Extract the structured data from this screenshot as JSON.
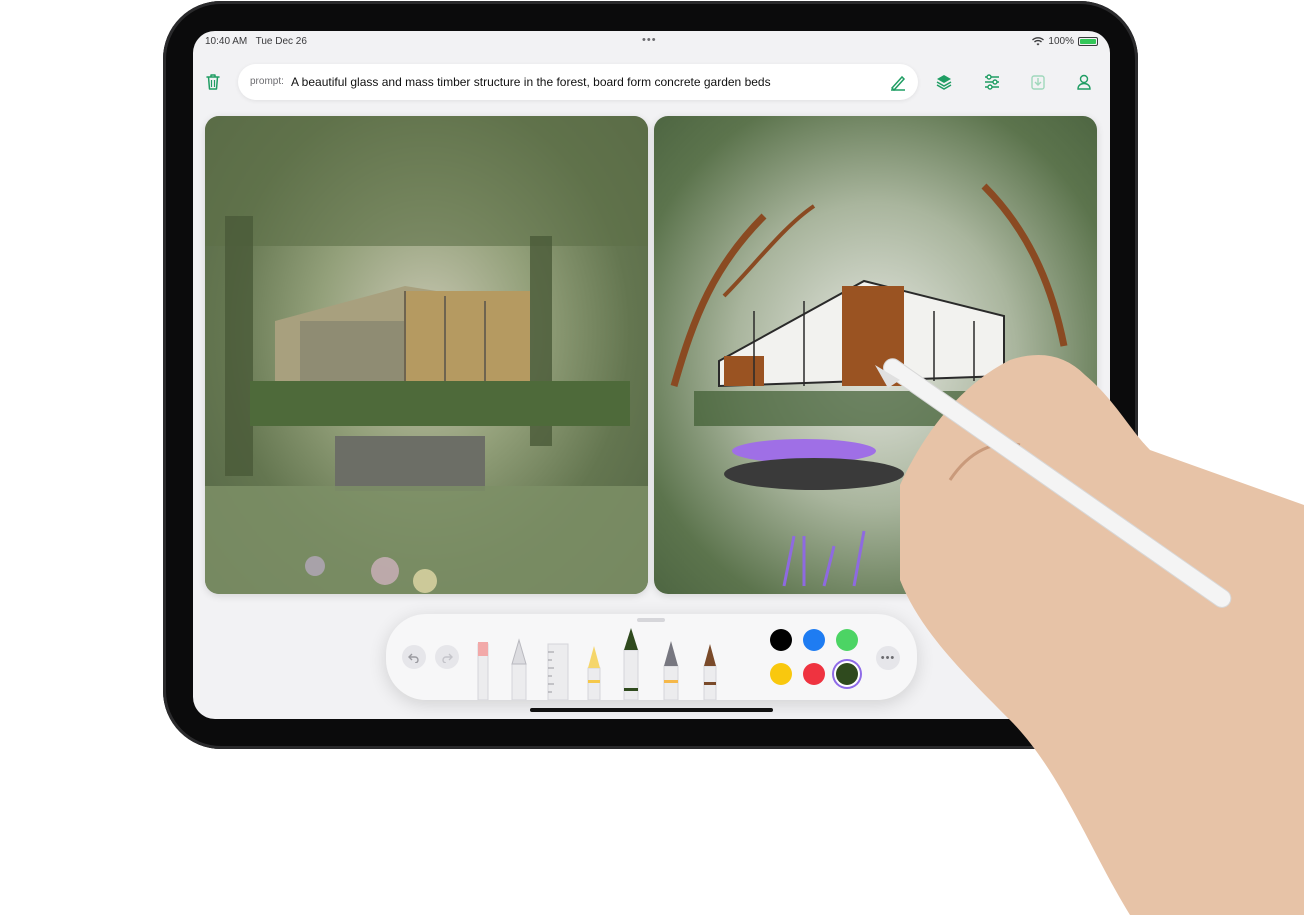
{
  "status_bar": {
    "time": "10:40 AM",
    "date": "Tue Dec 26",
    "more": "•••",
    "battery": "100%"
  },
  "toolbar": {
    "prompt_label": "prompt:",
    "prompt_text": "A beautiful glass and mass timber structure in the forest, board form concrete garden beds",
    "icons": [
      "trash-icon",
      "pencil-icon",
      "layers-icon",
      "sliders-icon",
      "download-icon",
      "person-icon"
    ]
  },
  "canvases": {
    "left": "generated render",
    "right": "sketch"
  },
  "drawing_tools": {
    "tools": [
      "eraser",
      "lasso",
      "ruler",
      "pencil",
      "marker",
      "fountain-pen",
      "brush"
    ],
    "colors": [
      "#000000",
      "#1e7cf2",
      "#4cd464",
      "#f9c80e",
      "#ef3340",
      "#2f4a1e"
    ]
  },
  "accent_color": "#1f9d63"
}
